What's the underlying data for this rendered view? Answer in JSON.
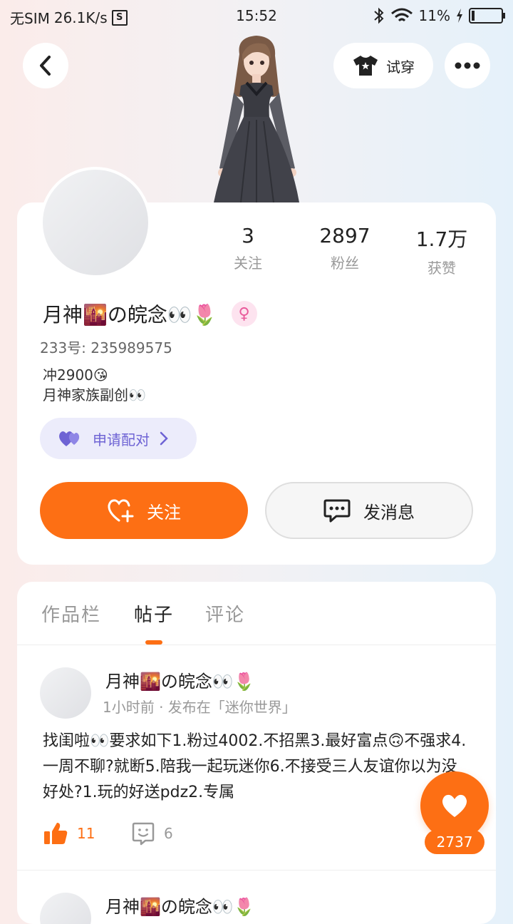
{
  "status_bar": {
    "carrier": "无SIM",
    "speed": "26.1K/s",
    "sim_icon_letter": "S",
    "time": "15:52",
    "battery": "11%",
    "battery_level": 0.11
  },
  "header": {
    "tryon_label": "试穿"
  },
  "profile": {
    "stats": [
      {
        "value": "3",
        "label": "关注"
      },
      {
        "value": "2897",
        "label": "粉丝"
      },
      {
        "value": "1.7万",
        "label": "获赞"
      }
    ],
    "nickname": "月神🌇の皖念👀🌷",
    "gender_symbol": "♀",
    "account_id": "233号: 235989575",
    "bio_lines": [
      "冲2900😘",
      "月神家族副创👀"
    ],
    "pair_label": "申请配对",
    "follow_label": "关注",
    "message_label": "发消息"
  },
  "tabs": [
    {
      "label": "作品栏",
      "active": false
    },
    {
      "label": "帖子",
      "active": true
    },
    {
      "label": "评论",
      "active": false
    }
  ],
  "posts": [
    {
      "author": "月神🌇の皖念👀🌷",
      "meta": "1小时前 · 发布在「迷你世界」",
      "text": "找闺啦👀要求如下1.粉过4002.不招黑3.最好富点🙃不强求4.一周不聊?就断5.陪我一起玩迷你6.不接受三人友谊你以为没好处?1.玩的好送pdz2.专属",
      "likes": "11",
      "comments": "6"
    },
    {
      "author": "月神🌇の皖念👀🌷"
    }
  ],
  "floating_like": {
    "count": "2737"
  },
  "colors": {
    "accent": "#fd6f14",
    "pair": "#6e63d4",
    "gender": "#e95a9b"
  }
}
